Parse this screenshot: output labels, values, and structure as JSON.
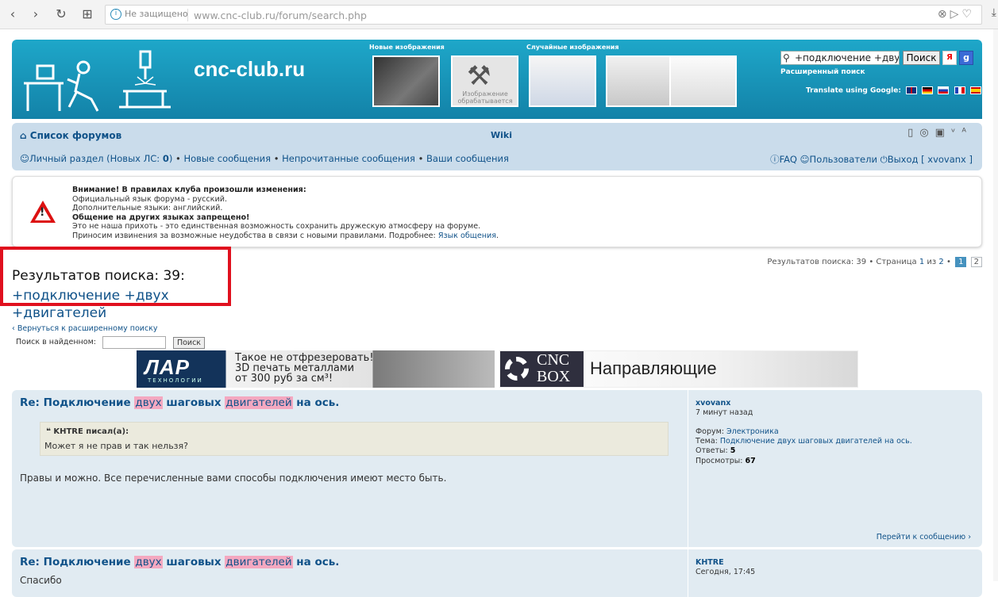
{
  "browser": {
    "security": "Не защищено",
    "url_host": "www.cnc-club.ru",
    "url_path": "/forum/search.php"
  },
  "header": {
    "site_name": "cnc-club.ru",
    "new_images": "Новые изображения",
    "random_images": "Случайные изображения",
    "processing_text": "Изображение обрабатывается",
    "search_value": "+подключение +двух",
    "search_button": "Поиск",
    "yandex": "Я",
    "google": "g",
    "advanced_search": "Расширенный поиск",
    "translate": "Translate using Google:"
  },
  "navbar": {
    "forum_list": "Список форумов",
    "wiki": "Wiki",
    "personal": "Личный раздел (Новых ЛС: ",
    "personal_count": "0",
    "personal_close": ")",
    "new_posts": "Новые сообщения",
    "unread": "Непрочитанные сообщения",
    "your_posts": "Ваши сообщения",
    "faq": "FAQ",
    "users": "Пользователи",
    "logout": "Выход [ xvovanx ]"
  },
  "notice": {
    "line1": "Внимание! В правилах клуба произошли изменения:",
    "line2": "Официальный язык форума - русский.",
    "line3": "Дополнительные языки: английский.",
    "line4": "Общение на других языках запрещено!",
    "line5": "Это не наша прихоть - это единственная возможность сохранить дружескую атмосферу на форуме.",
    "line6": "Приносим извинения за возможные неудобства в связи с новыми правилами. Подробнее: ",
    "line6_link": "Язык общения",
    "line6_end": "."
  },
  "results": {
    "title": "Результатов поиска: 39:",
    "query": "+подключение +двух +двигателей",
    "pagination_text": "Результатов поиска: 39 • Страница ",
    "page_current": "1",
    "page_of": " из ",
    "page_total": "2",
    "page_sep": " • ",
    "pages": [
      "1",
      "2"
    ],
    "back": "Вернуться к расширенному поиску",
    "search_in_label": "Поиск в найденном:",
    "search_in_button": "Поиск"
  },
  "banners": {
    "b1_logo": "ЛАР",
    "b1_sub": "ТЕХНОЛОГИИ",
    "b1_line1": "Такое не отфрезеровать!",
    "b1_line2": "3D печать металлами",
    "b1_line3": "от 300 руб за см³!",
    "b2_logo_top": "CNC",
    "b2_logo_bottom": "BOX",
    "b2_text": "Направляющие"
  },
  "posts": [
    {
      "title_prefix": "Re: Подключение ",
      "hl1": "двух",
      "title_mid": " шаговых ",
      "hl2": "двигателей",
      "title_suffix": " на ось.",
      "quote_author": "KHTRE писал(а):",
      "quote_text": "Может я не прав и так нельзя?",
      "body": "Правы и можно. Все перечисленные вами способы подключения имеют место быть.",
      "author": "xvovanx",
      "time": "7 минут назад",
      "forum_label": "Форум: ",
      "forum": "Электроника",
      "topic_label": "Тема: ",
      "topic": "Подключение двух шаговых двигателей на ось.",
      "replies_label": "Ответы: ",
      "replies": "5",
      "views_label": "Просмотры: ",
      "views": "67",
      "goto": "Перейти к сообщению"
    },
    {
      "title_prefix": "Re: Подключение ",
      "hl1": "двух",
      "title_mid": " шаговых ",
      "hl2": "двигателей",
      "title_suffix": " на ось.",
      "body": "Спасибо",
      "author": "KHTRE",
      "time": "Сегодня, 17:45"
    }
  ],
  "colors": {
    "header_accent": "#1ea7c9",
    "link": "#105289",
    "highlight": "#f4a8c0",
    "frame_red": "#e0101e"
  }
}
